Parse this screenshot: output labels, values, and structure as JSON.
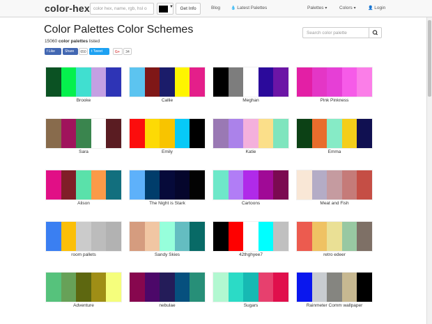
{
  "brand": "color-hex",
  "top_search": {
    "placeholder": "color hex, name, rgb, hsl o"
  },
  "selected_color": "#000000",
  "get_info_label": "Get Info",
  "nav": {
    "blog": "Blog",
    "latest": "Latest Palettes",
    "palettes": "Palettes",
    "colors": "Colors",
    "login": "Login"
  },
  "title": "Color Palettes Color Schemes",
  "count": {
    "number": "15060",
    "bold_text": "color palettes",
    "suffix": "listed"
  },
  "social": {
    "like": "Like",
    "share": "Share",
    "share_count": "650",
    "tweet": "Tweet",
    "gplus": "G+",
    "gplus_count": "34"
  },
  "palette_search": {
    "placeholder": "Search color palette"
  },
  "palettes": [
    {
      "name": "Brooke",
      "colors": [
        "#0b5223",
        "#05f04d",
        "#40dfd0",
        "#c4a0e3",
        "#2e34b6"
      ]
    },
    {
      "name": "Callie",
      "colors": [
        "#5cc4f0",
        "#7f1717",
        "#1b1c6a",
        "#fef500",
        "#e41f8a"
      ]
    },
    {
      "name": "Meghan",
      "colors": [
        "#000000",
        "#7d7d7d",
        "#ffffff",
        "#2b0a9b",
        "#6c15a6"
      ]
    },
    {
      "name": "Pink Pinkness",
      "colors": [
        "#e31fa5",
        "#e436c6",
        "#e63fd6",
        "#f65be8",
        "#fb7ee8"
      ]
    },
    {
      "name": "Sara",
      "colors": [
        "#886b4c",
        "#a0135c",
        "#3a854e",
        "#ffffff",
        "#5a1c22"
      ]
    },
    {
      "name": "Emily",
      "colors": [
        "#fc0d0d",
        "#fdda05",
        "#f8c400",
        "#07c9f7",
        "#000000"
      ]
    },
    {
      "name": "Katie",
      "colors": [
        "#9a79b4",
        "#ab82ea",
        "#f4b0dc",
        "#fbdf8a",
        "#7fe5be"
      ]
    },
    {
      "name": "Emma",
      "colors": [
        "#0c4115",
        "#e86d2c",
        "#86ebc6",
        "#f4ce1a",
        "#101051"
      ]
    },
    {
      "name": "Alison",
      "colors": [
        "#e10f86",
        "#801e28",
        "#5ae1aa",
        "#fb9a48",
        "#126f7e"
      ]
    },
    {
      "name": "The Night is Stark",
      "colors": [
        "#5eb1fa",
        "#003d6b",
        "#060a3a",
        "#05062c",
        "#030303"
      ]
    },
    {
      "name": "Cartoons",
      "colors": [
        "#6ee8c9",
        "#b17df6",
        "#b02ae9",
        "#a00a96",
        "#7b0a51"
      ]
    },
    {
      "name": "Meat and Fish",
      "colors": [
        "#f9e7d6",
        "#b4acc6",
        "#c59ba0",
        "#c57b79",
        "#c54e45"
      ]
    },
    {
      "name": "room pallets",
      "colors": [
        "#3a7ff2",
        "#fbbf08",
        "#cbcbcb",
        "#bcbcbc",
        "#b2b2b2"
      ]
    },
    {
      "name": "Sandy Skies",
      "colors": [
        "#d59c7f",
        "#f1c6a3",
        "#96ffdb",
        "#64bdc1",
        "#086a66"
      ]
    },
    {
      "name": "42thghyee7",
      "colors": [
        "#000000",
        "#fe0000",
        "#ffffff",
        "#00ffff",
        "#c0c0c0"
      ]
    },
    {
      "name": "retro edeer",
      "colors": [
        "#ec5b4f",
        "#efc263",
        "#eae095",
        "#98c8a2",
        "#7e7066"
      ]
    },
    {
      "name": "Adventure",
      "colors": [
        "#56c27c",
        "#67a158",
        "#5d6710",
        "#9f8e16",
        "#f5fe7c"
      ]
    },
    {
      "name": "nebulae",
      "colors": [
        "#87074e",
        "#4c0869",
        "#241c59",
        "#06507e",
        "#278f78"
      ]
    },
    {
      "name": "Sugars",
      "colors": [
        "#b2f8d1",
        "#2bdbc6",
        "#17b9b3",
        "#e7406e",
        "#e00f4c"
      ]
    },
    {
      "name": "Rainmeter Comm wallpaper",
      "colors": [
        "#0a17ee",
        "#c8ccd0",
        "#858580",
        "#c7b891",
        "#000000"
      ]
    }
  ]
}
